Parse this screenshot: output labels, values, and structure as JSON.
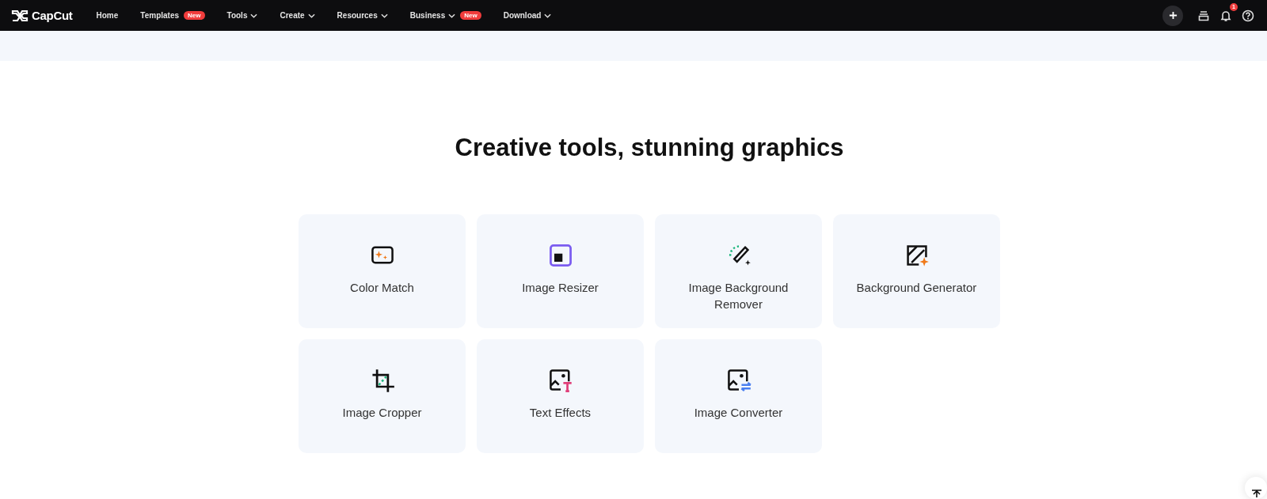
{
  "navbar": {
    "logo": "CapCut",
    "items": [
      {
        "label": "Home",
        "dropdown": false
      },
      {
        "label": "Templates",
        "dropdown": false,
        "badge": "New"
      },
      {
        "label": "Tools",
        "dropdown": true
      },
      {
        "label": "Create",
        "dropdown": true
      },
      {
        "label": "Resources",
        "dropdown": true
      },
      {
        "label": "Business",
        "dropdown": true,
        "badge": "New"
      },
      {
        "label": "Download",
        "dropdown": true
      }
    ],
    "notification_count": "1"
  },
  "section": {
    "title": "Creative tools, stunning graphics",
    "tools": [
      {
        "label": "Color Match",
        "kind": "match"
      },
      {
        "label": "Image Resizer",
        "kind": "resize"
      },
      {
        "label": "Image Background Remover",
        "kind": "remove"
      },
      {
        "label": "Background Generator",
        "kind": "generate"
      },
      {
        "label": "Image Cropper",
        "kind": "crop"
      },
      {
        "label": "Text Effects",
        "kind": "text"
      },
      {
        "label": "Image Converter",
        "kind": "convert"
      }
    ]
  }
}
